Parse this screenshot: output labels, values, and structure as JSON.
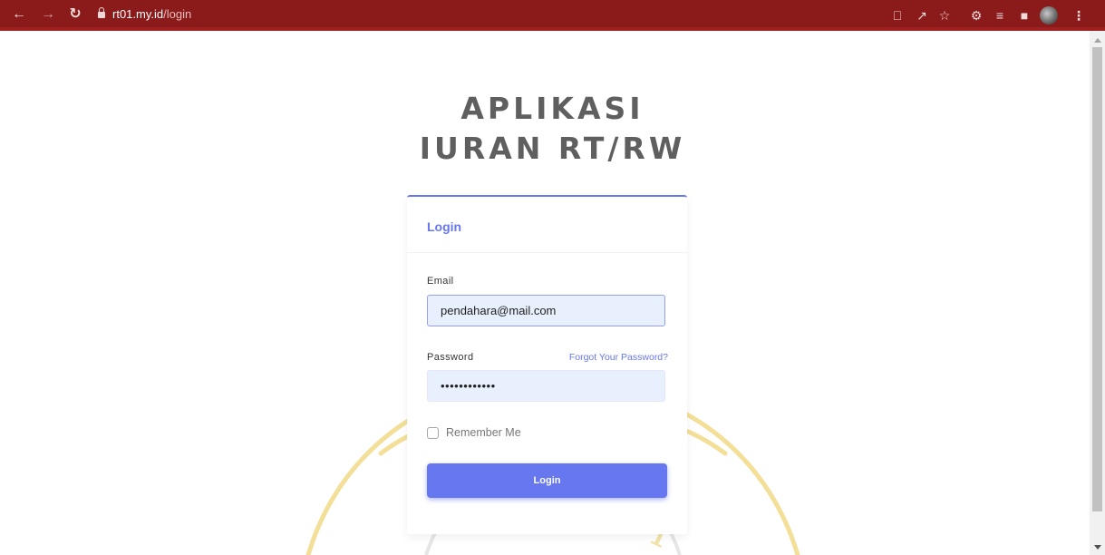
{
  "browser": {
    "url_host": "rt01.my.id",
    "url_path": "/login",
    "icons": [
      "back-icon",
      "forward-icon",
      "reload-icon",
      "lock-icon",
      "key-icon",
      "share-icon",
      "star-icon",
      "extensions-icon",
      "reading-list-icon",
      "side-panel-icon",
      "profile-avatar",
      "menu-icon"
    ]
  },
  "page": {
    "title_line1": "APLIKASI",
    "title_line2": "IURAN RT/RW"
  },
  "login": {
    "heading": "Login",
    "email_label": "Email",
    "email_value": "pendahara@mail.com",
    "password_label": "Password",
    "forgot_link": "Forgot Your Password?",
    "password_value": "••••••••••••",
    "remember_label": "Remember Me",
    "submit_label": "Login"
  },
  "colors": {
    "browser_bar": "#8b1a1a",
    "accent": "#6777ef",
    "title_text": "#5f5f5f",
    "input_bg": "#e8f0fe",
    "watermark": "#f4e3a0"
  }
}
